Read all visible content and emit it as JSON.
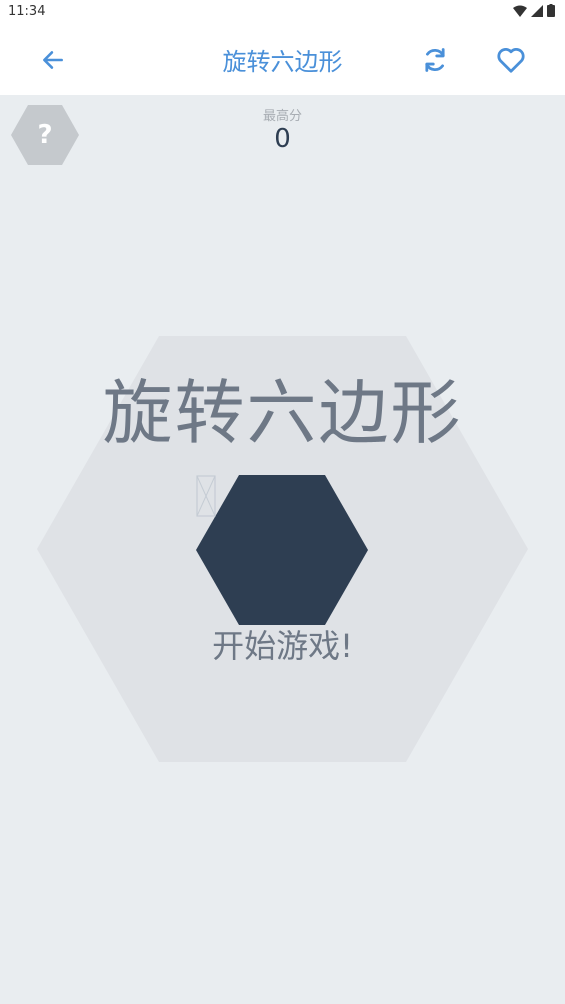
{
  "status_bar": {
    "time": "11:34"
  },
  "app_bar": {
    "title": "旋转六边形",
    "back_icon": "arrow-left-icon",
    "refresh_icon": "refresh-icon",
    "favorite_icon": "heart-icon"
  },
  "game": {
    "help_label": "?",
    "score_label": "最高分",
    "score_value": "0",
    "title": "旋转六边形",
    "start_label": "开始游戏!"
  },
  "colors": {
    "accent": "#4a90d9",
    "background": "#e9edf0",
    "dark_hex": "#2e3e52",
    "light_hex": "#dfe2e6",
    "help_hex": "#c5c9cd",
    "title_text": "#6e7886"
  }
}
